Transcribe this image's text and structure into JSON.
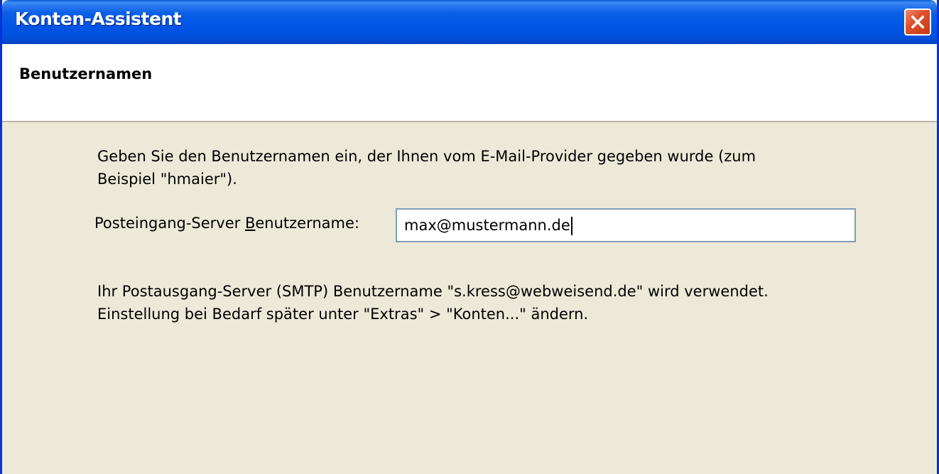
{
  "window": {
    "title": "Konten-Assistent"
  },
  "page": {
    "heading": "Benutzernamen"
  },
  "content": {
    "intro_line1": "Geben Sie den Benutzernamen ein, der Ihnen vom E-Mail-Provider gegeben wurde (zum",
    "intro_line2": "Beispiel \"hmaier\").",
    "field_label_prefix": "Posteingang-Server ",
    "field_label_accel": "B",
    "field_label_suffix": "enutzername:",
    "username_value": "max@mustermann.de",
    "outgoing_line1": "Ihr Postausgang-Server (SMTP) Benutzername \"s.kress@webweisend.de\" wird verwendet.",
    "outgoing_line2": "Einstellung bei Bedarf später unter \"Extras\" > \"Konten...\" ändern."
  },
  "icons": {
    "close": "close-icon"
  },
  "colors": {
    "titlebar": "#0055e5",
    "dialog_bg": "#ece9d8",
    "close_button": "#e0502c",
    "input_border": "#7f9db9"
  }
}
